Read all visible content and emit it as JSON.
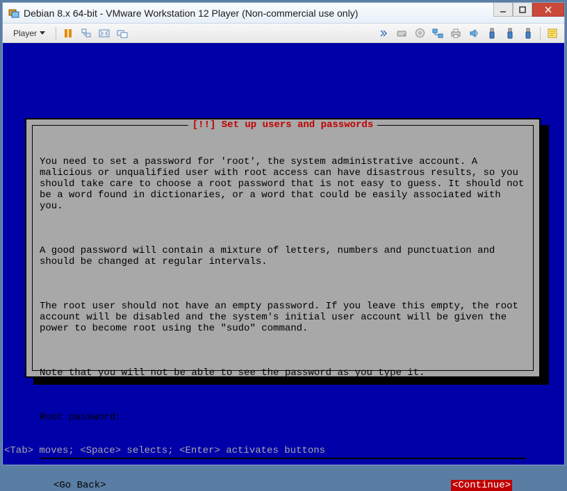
{
  "window": {
    "title": "Debian 8.x 64-bit - VMware Workstation 12 Player (Non-commercial use only)"
  },
  "toolbar": {
    "player_label": "Player"
  },
  "installer": {
    "dialog_title": "[!!] Set up users and passwords",
    "para1": "You need to set a password for 'root', the system administrative account. A malicious or unqualified user with root access can have disastrous results, so you should take care to choose a root password that is not easy to guess. It should not be a word found in dictionaries, or a word that could be easily associated with you.",
    "para2": "A good password will contain a mixture of letters, numbers and punctuation and should be changed at regular intervals.",
    "para3": "The root user should not have an empty password. If you leave this empty, the root account will be disabled and the system's initial user account will be given the power to become root using the \"sudo\" command.",
    "para4": "Note that you will not be able to see the password as you type it.",
    "field_label": "Root password:",
    "go_back": "<Go Back>",
    "continue": "<Continue>",
    "bottom_hint": "<Tab> moves; <Space> selects; <Enter> activates buttons"
  }
}
